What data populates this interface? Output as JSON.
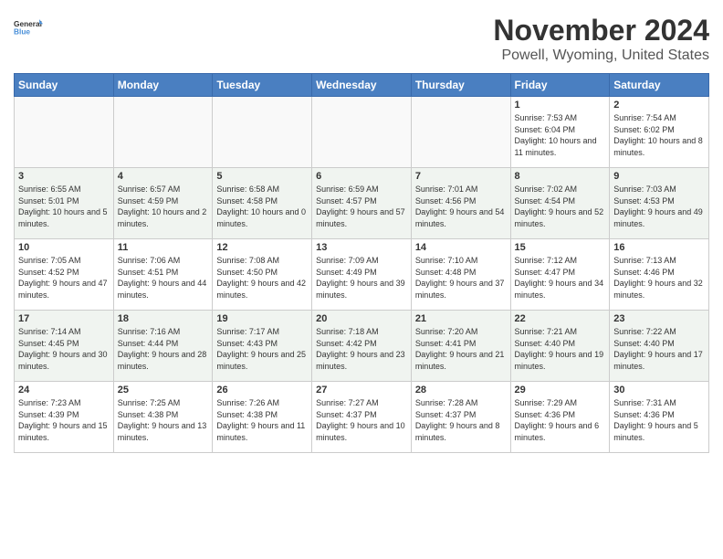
{
  "logo": {
    "general": "General",
    "blue": "Blue"
  },
  "header": {
    "month": "November 2024",
    "location": "Powell, Wyoming, United States"
  },
  "weekdays": [
    "Sunday",
    "Monday",
    "Tuesday",
    "Wednesday",
    "Thursday",
    "Friday",
    "Saturday"
  ],
  "weeks": [
    [
      {
        "day": "",
        "info": ""
      },
      {
        "day": "",
        "info": ""
      },
      {
        "day": "",
        "info": ""
      },
      {
        "day": "",
        "info": ""
      },
      {
        "day": "",
        "info": ""
      },
      {
        "day": "1",
        "info": "Sunrise: 7:53 AM\nSunset: 6:04 PM\nDaylight: 10 hours and 11 minutes."
      },
      {
        "day": "2",
        "info": "Sunrise: 7:54 AM\nSunset: 6:02 PM\nDaylight: 10 hours and 8 minutes."
      }
    ],
    [
      {
        "day": "3",
        "info": "Sunrise: 6:55 AM\nSunset: 5:01 PM\nDaylight: 10 hours and 5 minutes."
      },
      {
        "day": "4",
        "info": "Sunrise: 6:57 AM\nSunset: 4:59 PM\nDaylight: 10 hours and 2 minutes."
      },
      {
        "day": "5",
        "info": "Sunrise: 6:58 AM\nSunset: 4:58 PM\nDaylight: 10 hours and 0 minutes."
      },
      {
        "day": "6",
        "info": "Sunrise: 6:59 AM\nSunset: 4:57 PM\nDaylight: 9 hours and 57 minutes."
      },
      {
        "day": "7",
        "info": "Sunrise: 7:01 AM\nSunset: 4:56 PM\nDaylight: 9 hours and 54 minutes."
      },
      {
        "day": "8",
        "info": "Sunrise: 7:02 AM\nSunset: 4:54 PM\nDaylight: 9 hours and 52 minutes."
      },
      {
        "day": "9",
        "info": "Sunrise: 7:03 AM\nSunset: 4:53 PM\nDaylight: 9 hours and 49 minutes."
      }
    ],
    [
      {
        "day": "10",
        "info": "Sunrise: 7:05 AM\nSunset: 4:52 PM\nDaylight: 9 hours and 47 minutes."
      },
      {
        "day": "11",
        "info": "Sunrise: 7:06 AM\nSunset: 4:51 PM\nDaylight: 9 hours and 44 minutes."
      },
      {
        "day": "12",
        "info": "Sunrise: 7:08 AM\nSunset: 4:50 PM\nDaylight: 9 hours and 42 minutes."
      },
      {
        "day": "13",
        "info": "Sunrise: 7:09 AM\nSunset: 4:49 PM\nDaylight: 9 hours and 39 minutes."
      },
      {
        "day": "14",
        "info": "Sunrise: 7:10 AM\nSunset: 4:48 PM\nDaylight: 9 hours and 37 minutes."
      },
      {
        "day": "15",
        "info": "Sunrise: 7:12 AM\nSunset: 4:47 PM\nDaylight: 9 hours and 34 minutes."
      },
      {
        "day": "16",
        "info": "Sunrise: 7:13 AM\nSunset: 4:46 PM\nDaylight: 9 hours and 32 minutes."
      }
    ],
    [
      {
        "day": "17",
        "info": "Sunrise: 7:14 AM\nSunset: 4:45 PM\nDaylight: 9 hours and 30 minutes."
      },
      {
        "day": "18",
        "info": "Sunrise: 7:16 AM\nSunset: 4:44 PM\nDaylight: 9 hours and 28 minutes."
      },
      {
        "day": "19",
        "info": "Sunrise: 7:17 AM\nSunset: 4:43 PM\nDaylight: 9 hours and 25 minutes."
      },
      {
        "day": "20",
        "info": "Sunrise: 7:18 AM\nSunset: 4:42 PM\nDaylight: 9 hours and 23 minutes."
      },
      {
        "day": "21",
        "info": "Sunrise: 7:20 AM\nSunset: 4:41 PM\nDaylight: 9 hours and 21 minutes."
      },
      {
        "day": "22",
        "info": "Sunrise: 7:21 AM\nSunset: 4:40 PM\nDaylight: 9 hours and 19 minutes."
      },
      {
        "day": "23",
        "info": "Sunrise: 7:22 AM\nSunset: 4:40 PM\nDaylight: 9 hours and 17 minutes."
      }
    ],
    [
      {
        "day": "24",
        "info": "Sunrise: 7:23 AM\nSunset: 4:39 PM\nDaylight: 9 hours and 15 minutes."
      },
      {
        "day": "25",
        "info": "Sunrise: 7:25 AM\nSunset: 4:38 PM\nDaylight: 9 hours and 13 minutes."
      },
      {
        "day": "26",
        "info": "Sunrise: 7:26 AM\nSunset: 4:38 PM\nDaylight: 9 hours and 11 minutes."
      },
      {
        "day": "27",
        "info": "Sunrise: 7:27 AM\nSunset: 4:37 PM\nDaylight: 9 hours and 10 minutes."
      },
      {
        "day": "28",
        "info": "Sunrise: 7:28 AM\nSunset: 4:37 PM\nDaylight: 9 hours and 8 minutes."
      },
      {
        "day": "29",
        "info": "Sunrise: 7:29 AM\nSunset: 4:36 PM\nDaylight: 9 hours and 6 minutes."
      },
      {
        "day": "30",
        "info": "Sunrise: 7:31 AM\nSunset: 4:36 PM\nDaylight: 9 hours and 5 minutes."
      }
    ]
  ]
}
